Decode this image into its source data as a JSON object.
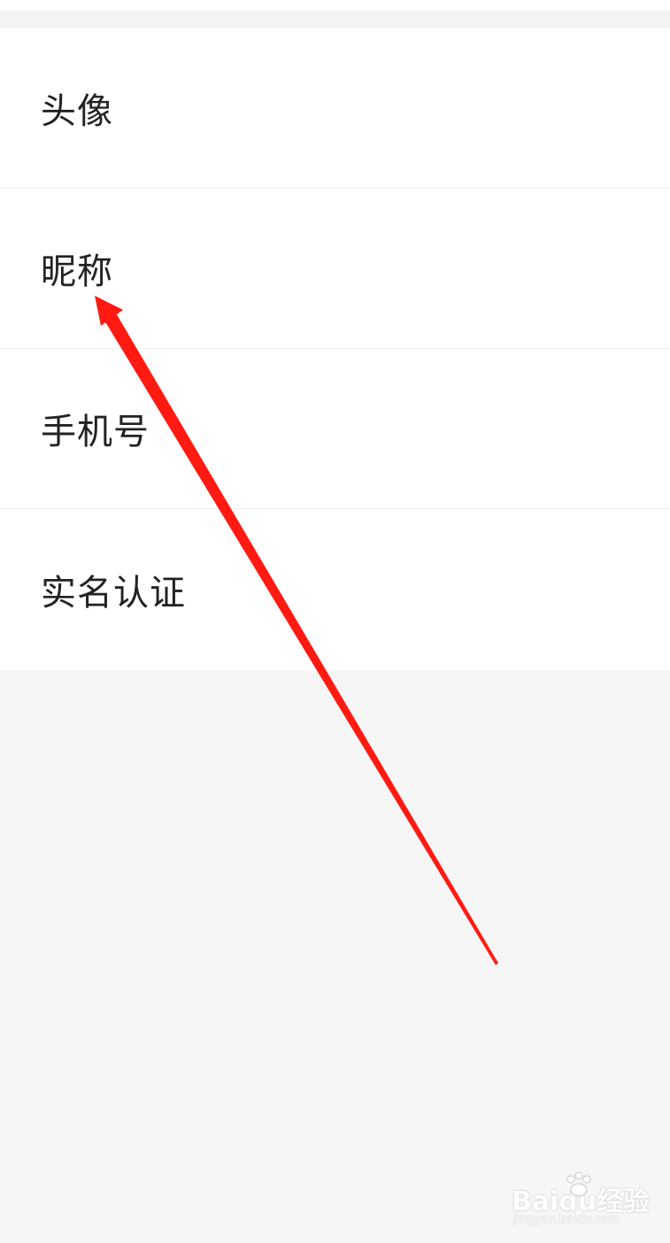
{
  "settings_list": {
    "items": [
      {
        "label": "头像"
      },
      {
        "label": "昵称"
      },
      {
        "label": "手机号"
      },
      {
        "label": "实名认证"
      }
    ]
  },
  "annotation": {
    "arrow_color": "#ff1a12"
  },
  "watermark": {
    "logo_text": "Baidu经验",
    "url": "jingyan.baidu.com"
  }
}
